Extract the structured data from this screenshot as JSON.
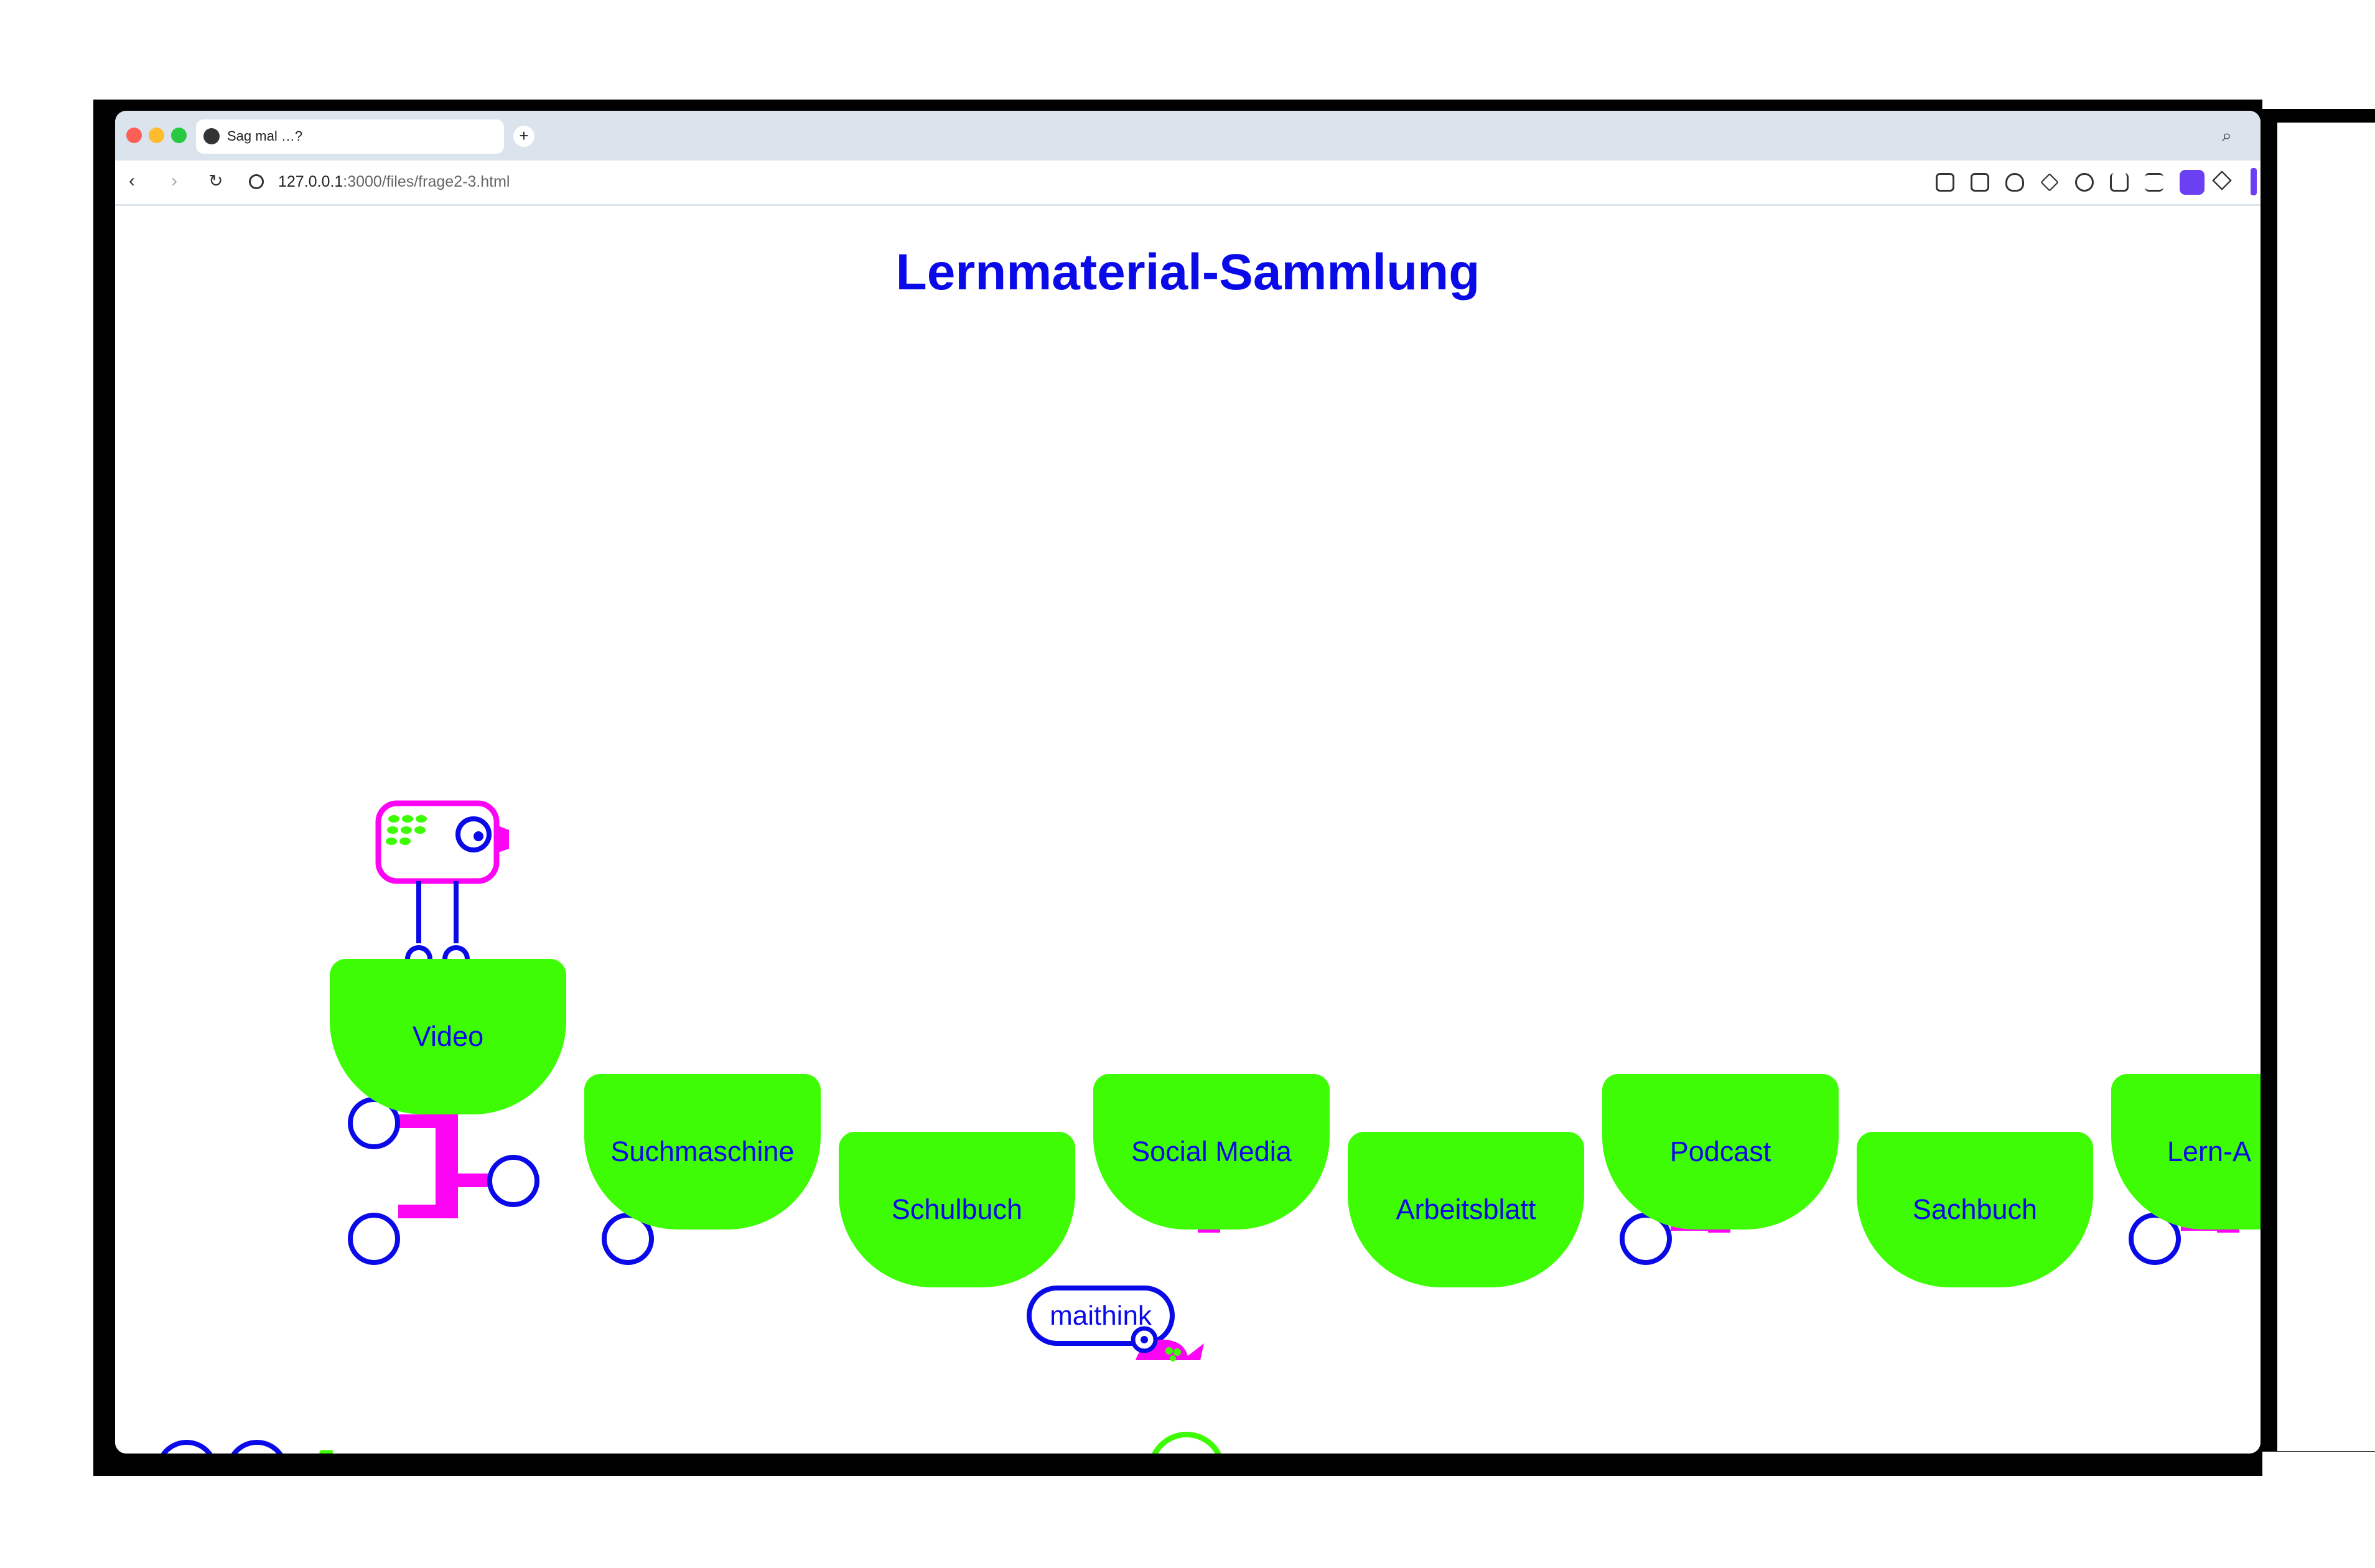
{
  "browser": {
    "tab_title": "Sag mal …?",
    "new_tab_symbol": "+",
    "url_host": "127.0.0.1",
    "url_path": ":3000/files/frage2-3.html"
  },
  "page": {
    "title": "Lernmaterial-Sammlung",
    "cards": [
      "Video",
      "Suchmaschine",
      "Schulbuch",
      "Social Media",
      "Arbeitsblatt",
      "Podcast",
      "Sachbuch",
      "Lern-A"
    ],
    "maithink_label": "maithink"
  },
  "colors": {
    "accent_green": "#3dfc04",
    "accent_magenta": "#fc05f4",
    "text_blue": "#0a0ae8"
  },
  "icons": {
    "reset": "↺",
    "next": "arrow-right-circle-icon"
  }
}
